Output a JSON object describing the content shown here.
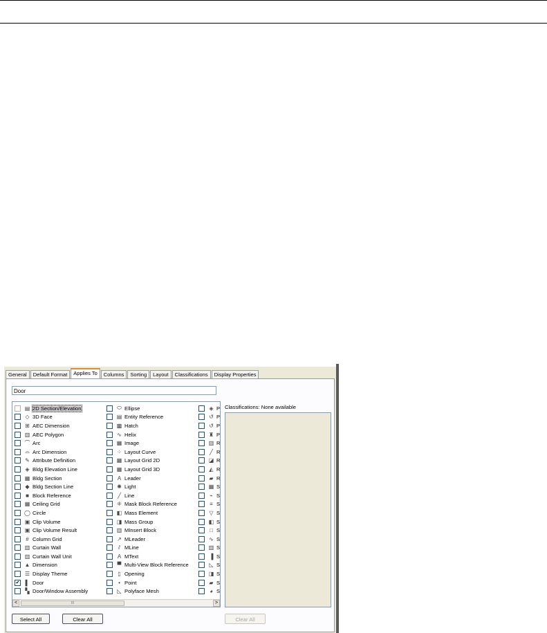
{
  "tabs": [
    "General",
    "Default Format",
    "Applies To",
    "Columns",
    "Sorting",
    "Layout",
    "Classifications",
    "Display Properties"
  ],
  "active_tab": "Applies To",
  "name_field": "Door",
  "objects": {
    "col1": [
      {
        "label": "2D Section/Elevation",
        "icon": "section-elevation-icon",
        "glyph": "▤",
        "checked": false,
        "selected": true
      },
      {
        "label": "3D Face",
        "icon": "3d-face-icon",
        "glyph": "◇",
        "checked": false
      },
      {
        "label": "AEC Dimension",
        "icon": "aec-dimension-icon",
        "glyph": "⊞",
        "checked": false
      },
      {
        "label": "AEC Polygon",
        "icon": "aec-polygon-icon",
        "glyph": "▥",
        "checked": false
      },
      {
        "label": "Arc",
        "icon": "arc-icon",
        "glyph": "⌒",
        "checked": false
      },
      {
        "label": "Arc Dimension",
        "icon": "arc-dimension-icon",
        "glyph": "⌓",
        "checked": false
      },
      {
        "label": "Attribute Definition",
        "icon": "attribute-definition-icon",
        "glyph": "✎",
        "checked": false
      },
      {
        "label": "Bldg Elevation Line",
        "icon": "bldg-elevation-line-icon",
        "glyph": "◈",
        "checked": false
      },
      {
        "label": "Bldg Section",
        "icon": "bldg-section-icon",
        "glyph": "▦",
        "checked": false
      },
      {
        "label": "Bldg Section Line",
        "icon": "bldg-section-line-icon",
        "glyph": "◆",
        "checked": false
      },
      {
        "label": "Block Reference",
        "icon": "block-reference-icon",
        "glyph": "■",
        "checked": false
      },
      {
        "label": "Ceiling Grid",
        "icon": "ceiling-grid-icon",
        "glyph": "▦",
        "checked": false
      },
      {
        "label": "Circle",
        "icon": "circle-icon",
        "glyph": "◯",
        "checked": false
      },
      {
        "label": "Clip Volume",
        "icon": "clip-volume-icon",
        "glyph": "▣",
        "checked": false
      },
      {
        "label": "Clip Volume Result",
        "icon": "clip-volume-result-icon",
        "glyph": "▣",
        "checked": false
      },
      {
        "label": "Column Grid",
        "icon": "column-grid-icon",
        "glyph": "#",
        "checked": false
      },
      {
        "label": "Curtain Wall",
        "icon": "curtain-wall-icon",
        "glyph": "▥",
        "checked": false
      },
      {
        "label": "Curtain Wall Unit",
        "icon": "curtain-wall-unit-icon",
        "glyph": "▥",
        "checked": false
      },
      {
        "label": "Dimension",
        "icon": "dimension-icon",
        "glyph": "▲",
        "checked": false
      },
      {
        "label": "Display Theme",
        "icon": "display-theme-icon",
        "glyph": "☰",
        "checked": false
      },
      {
        "label": "Door",
        "icon": "door-icon",
        "glyph": "▌",
        "checked": true
      },
      {
        "label": "Door/Window Assembly",
        "icon": "door-window-assembly-icon",
        "glyph": "▚",
        "checked": false
      }
    ],
    "col2": [
      {
        "label": "Ellipse",
        "icon": "ellipse-icon",
        "glyph": "⬭",
        "checked": false
      },
      {
        "label": "Entity Reference",
        "icon": "entity-reference-icon",
        "glyph": "▤",
        "checked": false
      },
      {
        "label": "Hatch",
        "icon": "hatch-icon",
        "glyph": "▩",
        "checked": false
      },
      {
        "label": "Helix",
        "icon": "helix-icon",
        "glyph": "∿",
        "checked": false
      },
      {
        "label": "Image",
        "icon": "image-icon",
        "glyph": "▦",
        "checked": false
      },
      {
        "label": "Layout Curve",
        "icon": "layout-curve-icon",
        "glyph": "⁘",
        "checked": false
      },
      {
        "label": "Layout Grid 2D",
        "icon": "layout-grid-2d-icon",
        "glyph": "▦",
        "checked": false
      },
      {
        "label": "Layout Grid 3D",
        "icon": "layout-grid-3d-icon",
        "glyph": "▦",
        "checked": false
      },
      {
        "label": "Leader",
        "icon": "leader-icon",
        "glyph": "A",
        "checked": false
      },
      {
        "label": "Light",
        "icon": "light-icon",
        "glyph": "✺",
        "checked": false
      },
      {
        "label": "Line",
        "icon": "line-icon",
        "glyph": "╱",
        "checked": false
      },
      {
        "label": "Mask Block Reference",
        "icon": "mask-block-reference-icon",
        "glyph": "⁜",
        "checked": false
      },
      {
        "label": "Mass Element",
        "icon": "mass-element-icon",
        "glyph": "◧",
        "checked": false
      },
      {
        "label": "Mass Group",
        "icon": "mass-group-icon",
        "glyph": "◨",
        "checked": false
      },
      {
        "label": "MInsert Block",
        "icon": "minsert-block-icon",
        "glyph": "▥",
        "checked": false
      },
      {
        "label": "MLeader",
        "icon": "mleader-icon",
        "glyph": "↗",
        "checked": false
      },
      {
        "label": "MLine",
        "icon": "mline-icon",
        "glyph": "⫽",
        "checked": false
      },
      {
        "label": "MText",
        "icon": "mtext-icon",
        "glyph": "A",
        "checked": false
      },
      {
        "label": "Multi-View Block Reference",
        "icon": "multi-view-block-reference-icon",
        "glyph": "▀",
        "checked": false
      },
      {
        "label": "Opening",
        "icon": "opening-icon",
        "glyph": "▯",
        "checked": false
      },
      {
        "label": "Point",
        "icon": "point-icon",
        "glyph": "•",
        "checked": false
      },
      {
        "label": "Polyface Mesh",
        "icon": "polyface-mesh-icon",
        "glyph": "◺",
        "checked": false
      }
    ],
    "col3": [
      {
        "label": "P",
        "icon": "truncated-p1-icon",
        "glyph": "◈",
        "checked": false
      },
      {
        "label": "P",
        "icon": "truncated-p2-icon",
        "glyph": "↺",
        "checked": false
      },
      {
        "label": "P",
        "icon": "truncated-p3-icon",
        "glyph": "↺",
        "checked": false
      },
      {
        "label": "P",
        "icon": "truncated-p4-icon",
        "glyph": "♜",
        "checked": false
      },
      {
        "label": "R",
        "icon": "truncated-r1-icon",
        "glyph": "▥",
        "checked": false
      },
      {
        "label": "R",
        "icon": "truncated-r2-icon",
        "glyph": "╱",
        "checked": false
      },
      {
        "label": "R",
        "icon": "truncated-r3-icon",
        "glyph": "◪",
        "checked": false
      },
      {
        "label": "R",
        "icon": "truncated-r4-icon",
        "glyph": "◭",
        "checked": false
      },
      {
        "label": "R",
        "icon": "truncated-r5-icon",
        "glyph": "▰",
        "checked": false
      },
      {
        "label": "S",
        "icon": "truncated-s1-icon",
        "glyph": "▦",
        "checked": false
      },
      {
        "label": "S",
        "icon": "truncated-s2-icon",
        "glyph": "⌁",
        "checked": false
      },
      {
        "label": "S",
        "icon": "truncated-s3-icon",
        "glyph": "≡",
        "checked": false
      },
      {
        "label": "S",
        "icon": "truncated-s4-icon",
        "glyph": "▽",
        "checked": false
      },
      {
        "label": "S",
        "icon": "truncated-s5-icon",
        "glyph": "◧",
        "checked": false
      },
      {
        "label": "S",
        "icon": "truncated-s6-icon",
        "glyph": "□",
        "checked": false
      },
      {
        "label": "S",
        "icon": "truncated-s7-icon",
        "glyph": "∿",
        "checked": false
      },
      {
        "label": "S",
        "icon": "truncated-s8-icon",
        "glyph": "▥",
        "checked": false
      },
      {
        "label": "S",
        "icon": "truncated-s9-icon",
        "glyph": "▐",
        "checked": false
      },
      {
        "label": "S",
        "icon": "truncated-s10-icon",
        "glyph": "◺",
        "checked": false
      },
      {
        "label": "S",
        "icon": "truncated-s11-icon",
        "glyph": "◨",
        "checked": false
      },
      {
        "label": "S",
        "icon": "truncated-s12-icon",
        "glyph": "▰",
        "checked": false
      },
      {
        "label": "S",
        "icon": "truncated-s13-icon",
        "glyph": "◕",
        "checked": false
      }
    ]
  },
  "scrollbar": {
    "left_arrow": "<",
    "right_arrow": ">",
    "thumb_grip": "III"
  },
  "classifications_label": "Classifications: None available",
  "buttons": {
    "select_all": "Select All",
    "clear_all": "Clear All",
    "class_clear_all": "Clear All"
  }
}
